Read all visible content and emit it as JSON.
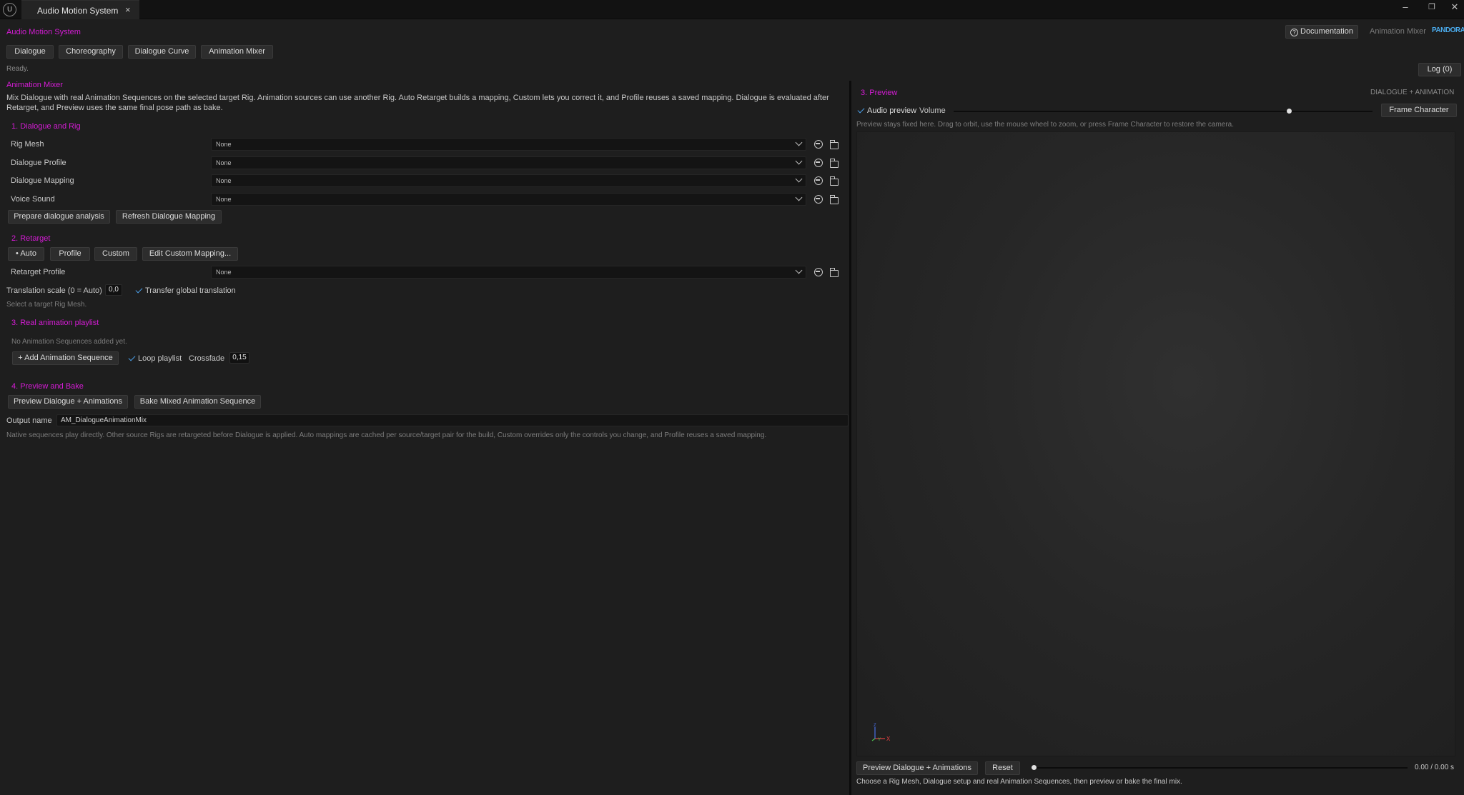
{
  "window": {
    "logo": "U",
    "tab_title": "Audio Motion System",
    "tab_close": "×",
    "minimize": "–",
    "maximize": "❐",
    "close": "✕"
  },
  "header": {
    "title": "Audio Motion System",
    "documentation": "Documentation",
    "documentation_icon": "?",
    "mode_label": "Animation Mixer",
    "brand": "PANDORA"
  },
  "tabs": [
    "Dialogue",
    "Choreography",
    "Dialogue Curve",
    "Animation Mixer"
  ],
  "status": {
    "text": "Ready.",
    "log": "Log (0)"
  },
  "mixer": {
    "title": "Animation Mixer",
    "description": "Mix Dialogue with real Animation Sequences on the selected target Rig. Animation sources can use another Rig. Auto Retarget builds a mapping, Custom lets you correct it, and Profile reuses a saved mapping. Dialogue is evaluated after Retarget, and Preview uses the same final pose path as bake."
  },
  "section1": {
    "title": "1. Dialogue and Rig",
    "rows": [
      {
        "label": "Rig Mesh",
        "value": "None"
      },
      {
        "label": "Dialogue Profile",
        "value": "None"
      },
      {
        "label": "Dialogue Mapping",
        "value": "None"
      },
      {
        "label": "Voice Sound",
        "value": "None"
      }
    ],
    "prepare": "Prepare dialogue analysis",
    "refresh": "Refresh Dialogue Mapping"
  },
  "section2": {
    "title": "2. Retarget",
    "modes": [
      "• Auto",
      "Profile",
      "Custom",
      "Edit Custom Mapping..."
    ],
    "profile_label": "Retarget Profile",
    "profile_value": "None",
    "scale_label": "Translation scale (0 = Auto)",
    "scale_value": "0,0",
    "transfer_label": "Transfer global translation",
    "hint": "Select a target Rig Mesh."
  },
  "section3": {
    "title": "3. Real animation playlist",
    "empty": "No Animation Sequences added yet.",
    "add": "+ Add Animation Sequence",
    "loop_label": "Loop playlist",
    "crossfade_label": "Crossfade",
    "crossfade_value": "0,15"
  },
  "section4": {
    "title": "4. Preview and Bake",
    "preview": "Preview Dialogue + Animations",
    "bake": "Bake Mixed Animation Sequence",
    "output_label": "Output name",
    "output_value": "AM_DialogueAnimationMix",
    "note": "Native sequences play directly. Other source Rigs are retargeted before Dialogue is applied. Auto mappings are cached per source/target pair for the build, Custom overrides only the controls you change, and Profile reuses a saved mapping."
  },
  "preview": {
    "title": "3. Preview",
    "subtitle": "DIALOGUE + ANIMATION",
    "audio_label": "Audio preview",
    "volume_label": "Volume",
    "volume_fraction": 0.8,
    "frame_button": "Frame Character",
    "hint": "Preview stays fixed here. Drag to orbit, use the mouse wheel to zoom, or press Frame Character to restore the camera.",
    "play_button": "Preview Dialogue + Animations",
    "reset_button": "Reset",
    "time": "0.00 / 0.00 s",
    "timeline_fraction": 0,
    "footer": "Choose a Rig Mesh, Dialogue setup and real Animation Sequences, then preview or bake the final mix.",
    "axis_x": "X",
    "axis_y": "Y",
    "axis_z": "Z"
  },
  "colors": {
    "accent": "#d41cd4",
    "check": "#4a9ee8",
    "background": "#1e1e1e"
  }
}
